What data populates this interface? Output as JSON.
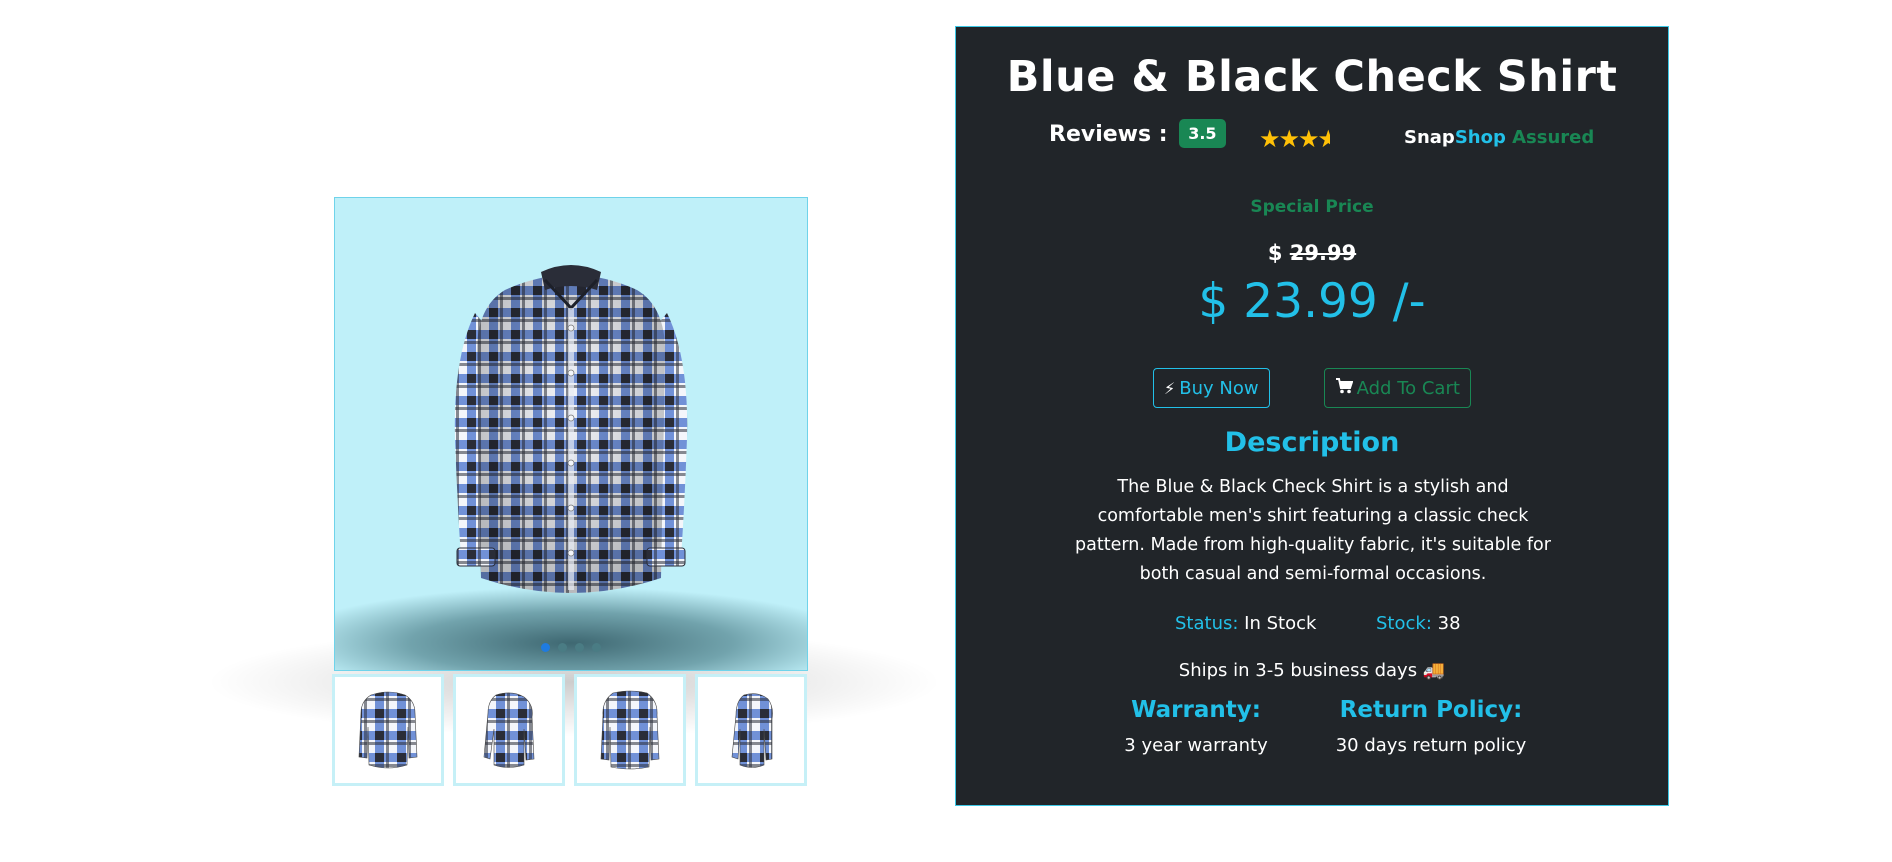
{
  "product": {
    "title": "Blue & Black Check Shirt",
    "reviews_label": "Reviews :",
    "rating": "3.5",
    "stars": 3.5,
    "brand_snap": "Snap",
    "brand_shop": "Shop",
    "brand_assured": "Assured",
    "special_price_label": "Special Price",
    "old_currency": "$",
    "old_price": "29.99",
    "price": "$ 23.99 /-",
    "buy_now_label": "Buy Now",
    "add_to_cart_label": "Add To Cart",
    "description_title": "Description",
    "description": "The Blue & Black Check Shirt is a stylish and comfortable men's shirt featuring a classic check pattern. Made from high-quality fabric, it's suitable for both casual and semi-formal occasions.",
    "status_label": "Status:",
    "status_value": "In Stock",
    "stock_label": "Stock:",
    "stock_value": "38",
    "shipping": "Ships in 3-5 business days 🚚",
    "warranty_title": "Warranty:",
    "warranty_value": "3 year warranty",
    "return_title": "Return Policy:",
    "return_value": "30 days return policy"
  },
  "gallery": {
    "slides": 4,
    "active_slide": 1,
    "thumbnails": [
      "shirt-front",
      "shirt-side",
      "shirt-back",
      "shirt-side-alt"
    ]
  },
  "colors": {
    "accent": "#22c0e8",
    "success": "#198754",
    "card_bg": "#212529",
    "star": "#ffc107",
    "image_bg": "#bff0f9"
  }
}
